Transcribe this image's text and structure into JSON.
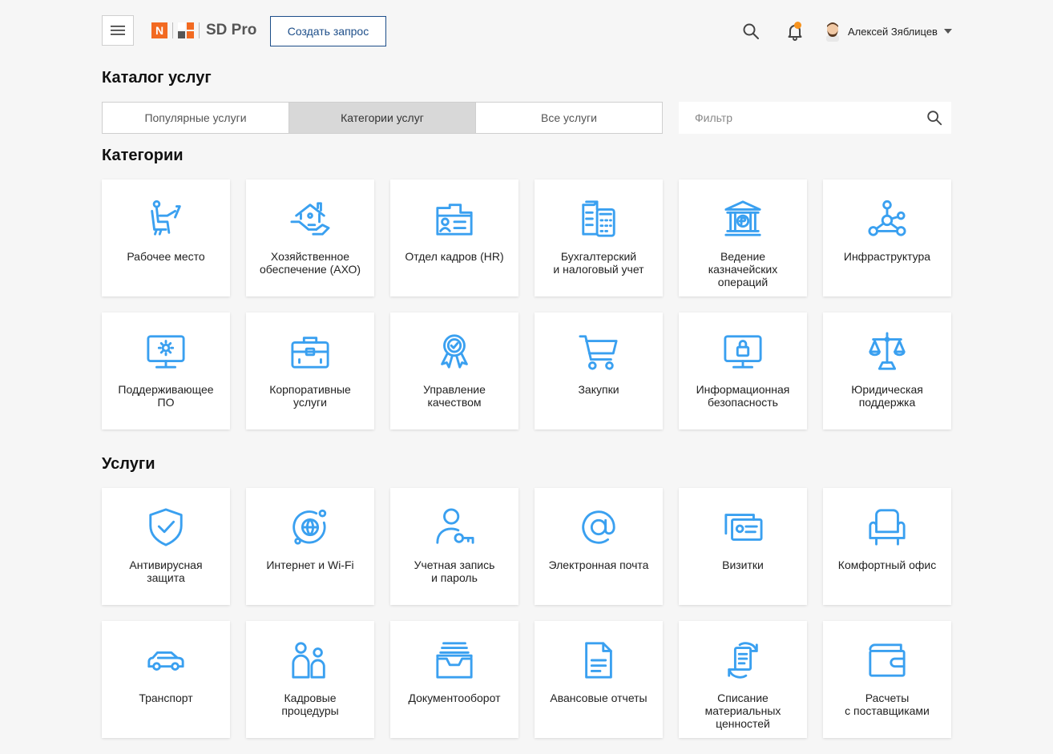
{
  "header": {
    "logo_text": "SD Pro",
    "logo_letter": "N",
    "create_button": "Создать запрос",
    "user_name": "Алексей Зяблицев",
    "icons": {
      "menu": "hamburger-icon",
      "search": "search-icon",
      "notifications": "bell-icon",
      "user_menu": "chevron-down-icon"
    },
    "notification_dot_color": "#f7931e"
  },
  "page_title": "Каталог услуг",
  "tabs": [
    {
      "label": "Популярные услуги",
      "active": false
    },
    {
      "label": "Категории услуг",
      "active": true
    },
    {
      "label": "Все услуги",
      "active": false
    }
  ],
  "filter": {
    "placeholder": "Фильтр",
    "value": ""
  },
  "categories": {
    "title": "Категории",
    "items": [
      {
        "label": "Рабочее место",
        "icon": "workplace-icon"
      },
      {
        "label": "Хозяйственное\nобеспечение (АХО)",
        "icon": "house-hand-icon"
      },
      {
        "label": "Отдел кадров (HR)",
        "icon": "hr-folder-icon"
      },
      {
        "label": "Бухгалтерский\nи налоговый учет",
        "icon": "accounting-calculator-icon"
      },
      {
        "label": "Ведение\nказначейских\nопераций",
        "icon": "bank-ruble-icon"
      },
      {
        "label": "Инфраструктура",
        "icon": "network-nodes-icon"
      },
      {
        "label": "Поддерживающее\nПО",
        "icon": "monitor-gear-icon"
      },
      {
        "label": "Корпоративные\nуслуги",
        "icon": "briefcase-icon"
      },
      {
        "label": "Управление\nкачеством",
        "icon": "quality-badge-icon"
      },
      {
        "label": "Закупки",
        "icon": "shopping-cart-icon"
      },
      {
        "label": "Информационная\nбезопасность",
        "icon": "monitor-lock-icon"
      },
      {
        "label": "Юридическая\nподдержка",
        "icon": "scales-icon"
      }
    ]
  },
  "services": {
    "title": "Услуги",
    "items": [
      {
        "label": "Антивирусная\nзащита",
        "icon": "shield-check-icon"
      },
      {
        "label": "Интернет и Wi-Fi",
        "icon": "globe-wifi-icon"
      },
      {
        "label": "Учетная запись\nи пароль",
        "icon": "user-key-icon"
      },
      {
        "label": "Электронная почта",
        "icon": "at-sign-icon"
      },
      {
        "label": "Визитки",
        "icon": "business-cards-icon"
      },
      {
        "label": "Комфортный офис",
        "icon": "armchair-icon"
      },
      {
        "label": "Транспорт",
        "icon": "car-icon"
      },
      {
        "label": "Кадровые\nпроцедуры",
        "icon": "people-icon"
      },
      {
        "label": "Документооборот",
        "icon": "document-tray-icon"
      },
      {
        "label": "Авансовые отчеты",
        "icon": "document-icon"
      },
      {
        "label": "Списание\nматериальных\nценностей",
        "icon": "document-cycle-icon"
      },
      {
        "label": "Расчеты\nс поставщиками",
        "icon": "wallet-icon"
      }
    ]
  },
  "colors": {
    "accent_icon": "#3aa0f0",
    "brand_orange": "#f26a21",
    "button_border": "#1d4e89",
    "active_tab": "#d8d8d8"
  }
}
